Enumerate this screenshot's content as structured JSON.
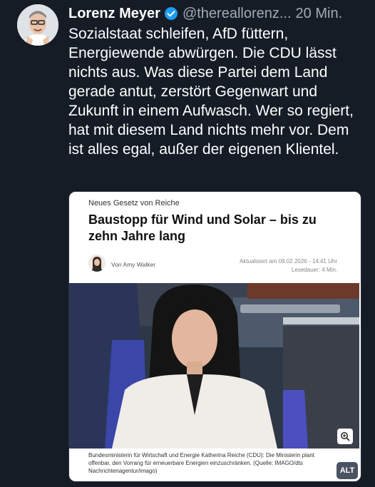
{
  "post": {
    "author_name": "Lorenz Meyer",
    "handle": "@thereallorenz...",
    "time": "20 Min.",
    "text": "Sozialstaat schleifen, AfD füttern, Energiewende abwürgen. Die CDU lässt nichts aus. Was diese Partei dem Land gerade antut, zerstört Gegenwart und Zukunft in einem Aufwasch. Wer so regiert, hat mit diesem Land nichts mehr vor. Dem ist alles egal, außer der eigenen Klientel."
  },
  "card": {
    "kicker": "Neues Gesetz von Reiche",
    "headline": "Baustopp für Wind und Solar – bis zu zehn Jahre lang",
    "byline": "Von Amy Walker",
    "updated": "Aktualisiert am 09.02.2026 - 14:41 Uhr",
    "reading_time": "Lesedauer: 4 Min.",
    "caption": "Bundesministerin für Wirtschaft und Energie Katherina Reiche (CDU): Die Ministerin plant offenbar, den Vorrang für erneuerbare Energien einzuschränken. (Quelle: IMAGO/dts Nachrichtenagentur/imago)",
    "alt_badge": "ALT"
  },
  "icons": {
    "verified": "verified-badge-icon",
    "zoom": "zoom-in-icon"
  },
  "colors": {
    "background": "#151c26",
    "verified": "#1d9bf0",
    "muted_text": "#a2aab6",
    "card": "#ffffff"
  }
}
